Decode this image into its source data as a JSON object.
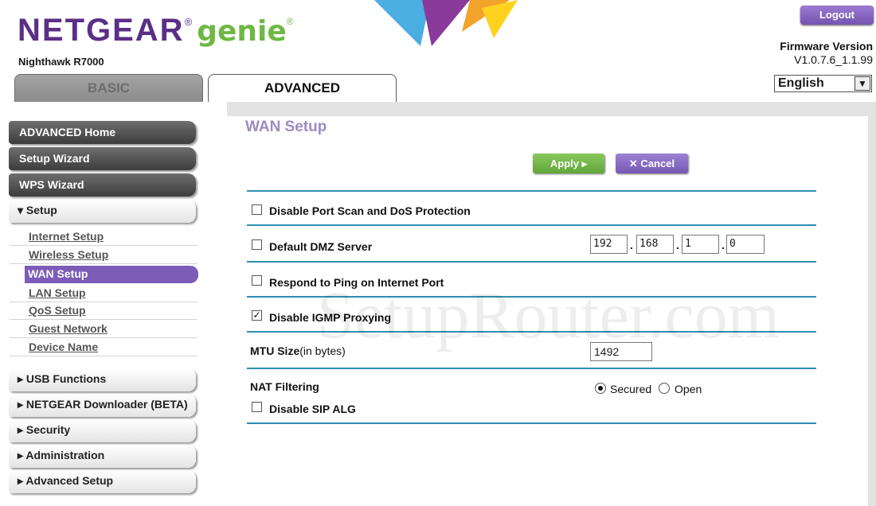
{
  "header": {
    "brand": "NETGEAR",
    "product": "genie",
    "model": "Nighthawk R7000",
    "tabs": [
      {
        "label": "BASIC"
      },
      {
        "label": "ADVANCED"
      }
    ],
    "logout_label": "Logout",
    "firmware_label": "Firmware Version",
    "firmware_value": "V1.0.7.6_1.1.99",
    "language": "English"
  },
  "sidebar": {
    "items": [
      {
        "label": "ADVANCED Home"
      },
      {
        "label": "Setup Wizard"
      },
      {
        "label": "WPS Wizard"
      },
      {
        "label": "▾ Setup"
      },
      {
        "label": "Internet Setup"
      },
      {
        "label": "Wireless Setup"
      },
      {
        "label": "WAN Setup"
      },
      {
        "label": "LAN Setup"
      },
      {
        "label": "QoS Setup"
      },
      {
        "label": "Guest Network"
      },
      {
        "label": "Device Name"
      },
      {
        "label": "▸ USB Functions"
      },
      {
        "label": "▸ NETGEAR Downloader (BETA)"
      },
      {
        "label": "▸ Security"
      },
      {
        "label": "▸ Administration"
      },
      {
        "label": "▸ Advanced Setup"
      }
    ]
  },
  "main": {
    "title": "WAN Setup",
    "apply_label": "Apply ▸",
    "cancel_label": "✕ Cancel",
    "rows": {
      "port_scan": {
        "label": "Disable Port Scan and DoS Protection",
        "checked": false
      },
      "dmz": {
        "label": "Default DMZ Server",
        "checked": false,
        "ip": [
          "192",
          "168",
          "1",
          "0"
        ]
      },
      "ping": {
        "label": "Respond to Ping on Internet Port",
        "checked": false
      },
      "igmp": {
        "label": "Disable IGMP Proxying",
        "checked": true
      },
      "mtu": {
        "label": "MTU Size",
        "label_suffix": "(in bytes)",
        "value": "1492"
      },
      "nat": {
        "label": "NAT Filtering",
        "options": [
          {
            "label": "Secured",
            "selected": true
          },
          {
            "label": "Open",
            "selected": false
          }
        ]
      },
      "sip": {
        "label": "Disable SIP ALG",
        "checked": false
      }
    },
    "checkmark": "✓"
  },
  "watermark": "SetupRouter.com",
  "colors": {
    "brand_purple": "#5b2f86",
    "genie_green": "#6fb845",
    "rule_blue": "#2e8fb0",
    "active_purple": "#7c5cb8",
    "title_lavender": "#9c8cc0"
  }
}
